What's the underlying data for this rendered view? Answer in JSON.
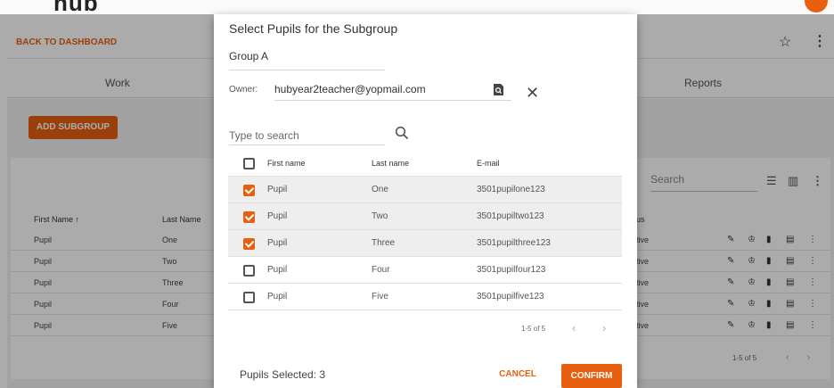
{
  "app": {
    "back_link": "BACK TO DASHBOARD",
    "tabs": [
      "Work",
      "Reports"
    ],
    "add_subgroup": "ADD SUBGROUP",
    "search_placeholder": "Search",
    "columns": [
      "First Name",
      "Last Name",
      "us"
    ],
    "sort_arrow": "↑",
    "rows": [
      {
        "first": "Pupil",
        "last": "One",
        "status": "tive"
      },
      {
        "first": "Pupil",
        "last": "Two",
        "status": "tive"
      },
      {
        "first": "Pupil",
        "last": "Three",
        "status": "tive"
      },
      {
        "first": "Pupil",
        "last": "Four",
        "status": "tive"
      },
      {
        "first": "Pupil",
        "last": "Five",
        "status": "tive"
      }
    ],
    "pager": "1-5 of 5"
  },
  "dialog": {
    "title": "Select Pupils for the Subgroup",
    "group_name": "Group A",
    "owner_label": "Owner:",
    "owner_value": "hubyear2teacher@yopmail.com",
    "search_placeholder": "Type to search",
    "columns": {
      "first": "First name",
      "last": "Last name",
      "email": "E-mail"
    },
    "pupils": [
      {
        "first": "Pupil",
        "last": "One",
        "email": "3501pupilone123",
        "checked": true
      },
      {
        "first": "Pupil",
        "last": "Two",
        "email": "3501pupiltwo123",
        "checked": true
      },
      {
        "first": "Pupil",
        "last": "Three",
        "email": "3501pupilthree123",
        "checked": true
      },
      {
        "first": "Pupil",
        "last": "Four",
        "email": "3501pupilfour123",
        "checked": false
      },
      {
        "first": "Pupil",
        "last": "Five",
        "email": "3501pupilfive123",
        "checked": false
      }
    ],
    "pager": "1-5 of 5",
    "pager_prev": "‹",
    "pager_next": "›",
    "selected_count": "Pupils Selected: 3",
    "cancel_label": "CANCEL",
    "confirm_label": "CONFIRM"
  },
  "colors": {
    "accent": "#e8600f",
    "selected_row": "#eeeeee"
  },
  "icons": [
    "star-icon",
    "kebab-menu-icon",
    "lookup-icon",
    "close-icon",
    "search-icon",
    "checkbox-icon",
    "filter-icon",
    "columns-icon",
    "edit-icon",
    "graduation-cap-icon",
    "bar-chart-icon",
    "comment-icon"
  ]
}
